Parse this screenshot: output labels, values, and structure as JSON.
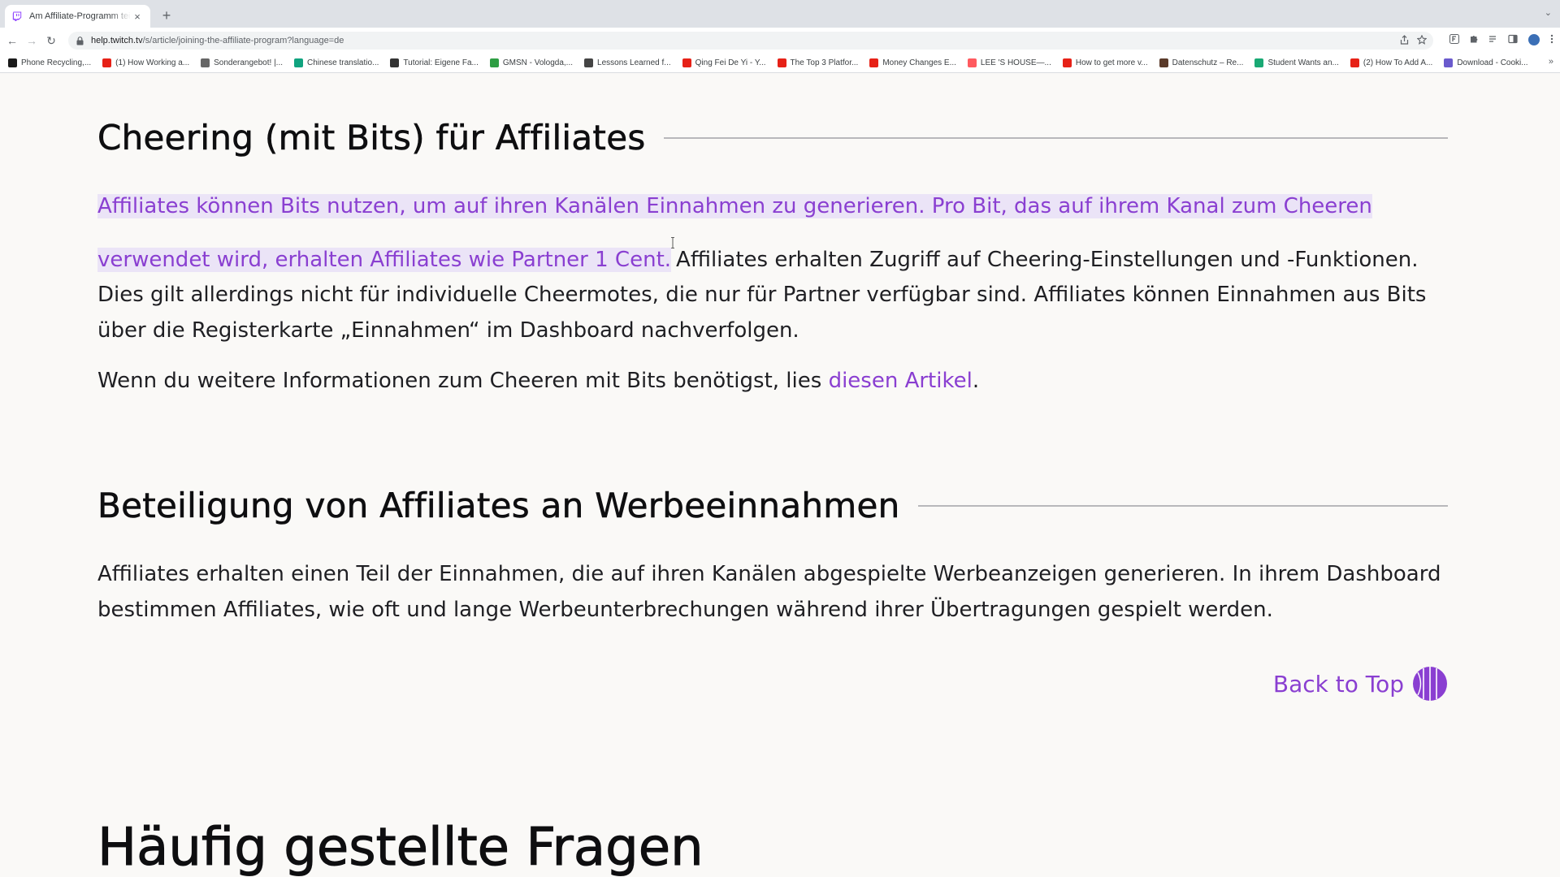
{
  "browser": {
    "tab": {
      "title": "Am Affiliate-Programm teilnehmen",
      "close": "×"
    },
    "new_tab": "+",
    "tab_menu": "⌄",
    "url": {
      "host": "help.twitch.tv",
      "path": "/s/article/joining-the-affiliate-program?language=de"
    },
    "nav": {
      "back": "←",
      "forward": "→",
      "reload": "↻"
    },
    "bookmarks": [
      {
        "label": "Phone Recycling,...",
        "color": "#1a1a1a",
        "icon": "ring-icon"
      },
      {
        "label": "(1) How Working a...",
        "color": "#e62117",
        "icon": "youtube-icon"
      },
      {
        "label": "Sonderangebot! |...",
        "color": "#666666",
        "icon": "tag-icon"
      },
      {
        "label": "Chinese translatio...",
        "color": "#10a37f",
        "icon": "openai-icon"
      },
      {
        "label": "Tutorial: Eigene Fa...",
        "color": "#333333",
        "icon": "hash-icon"
      },
      {
        "label": "GMSN - Vologda,...",
        "color": "#2e9e44",
        "icon": "gmsn-icon"
      },
      {
        "label": "Lessons Learned f...",
        "color": "#444444",
        "icon": "lessons-icon"
      },
      {
        "label": "Qing Fei De Yi - Y...",
        "color": "#e62117",
        "icon": "youtube-icon"
      },
      {
        "label": "The Top 3 Platfor...",
        "color": "#e62117",
        "icon": "youtube-icon"
      },
      {
        "label": "Money Changes E...",
        "color": "#e62117",
        "icon": "youtube-icon"
      },
      {
        "label": "LEE 'S HOUSE—...",
        "color": "#ff5a5f",
        "icon": "airbnb-icon"
      },
      {
        "label": "How to get more v...",
        "color": "#e62117",
        "icon": "youtube-icon"
      },
      {
        "label": "Datenschutz – Re...",
        "color": "#5a3a2a",
        "icon": "page-icon"
      },
      {
        "label": "Student Wants an...",
        "color": "#19a974",
        "icon": "green-icon"
      },
      {
        "label": "(2) How To Add A...",
        "color": "#e62117",
        "icon": "youtube-icon"
      },
      {
        "label": "Download - Cooki...",
        "color": "#6a5acd",
        "icon": "cookie-icon"
      }
    ],
    "bookmarks_more": "»"
  },
  "article": {
    "section1": {
      "title": "Cheering (mit Bits) für Affiliates",
      "para1_highlighted": "Affiliates können Bits nutzen, um auf ihren Kanälen Einnahmen zu generieren. Pro Bit, das auf ihrem Kanal zum Cheeren verwendet wird, erhalten Affiliates wie Partner 1 Cent.",
      "para1_rest": "Affiliates erhalten Zugriff auf Cheering-Einstellungen und -Funktionen. Dies gilt allerdings nicht für individuelle Cheermotes, die nur für Partner verfügbar sind. Affiliates können Einnahmen aus Bits über die Registerkarte „Einnahmen“ im Dashboard nachverfolgen.",
      "para2_text": "Wenn du weitere Informationen zum Cheeren mit Bits benötigst, lies ",
      "para2_link": "diesen Artikel",
      "para2_end": "."
    },
    "section2": {
      "title": "Beteiligung von Affiliates an Werbeeinnahmen",
      "para": "Affiliates erhalten einen Teil der Einnahmen, die auf ihren Kanälen abgespielte Werbeanzeigen generieren. In ihrem Dashboard bestimmen Affiliates, wie oft und lange Werbeunterbrechungen während ihrer Übertragungen gespielt werden."
    },
    "back_to_top": "Back to Top",
    "faq_title": "Häufig gestellte Fragen"
  },
  "colors": {
    "accent": "#8a3fd1",
    "highlight": "#ebe4f7",
    "text": "#1f1f23"
  }
}
